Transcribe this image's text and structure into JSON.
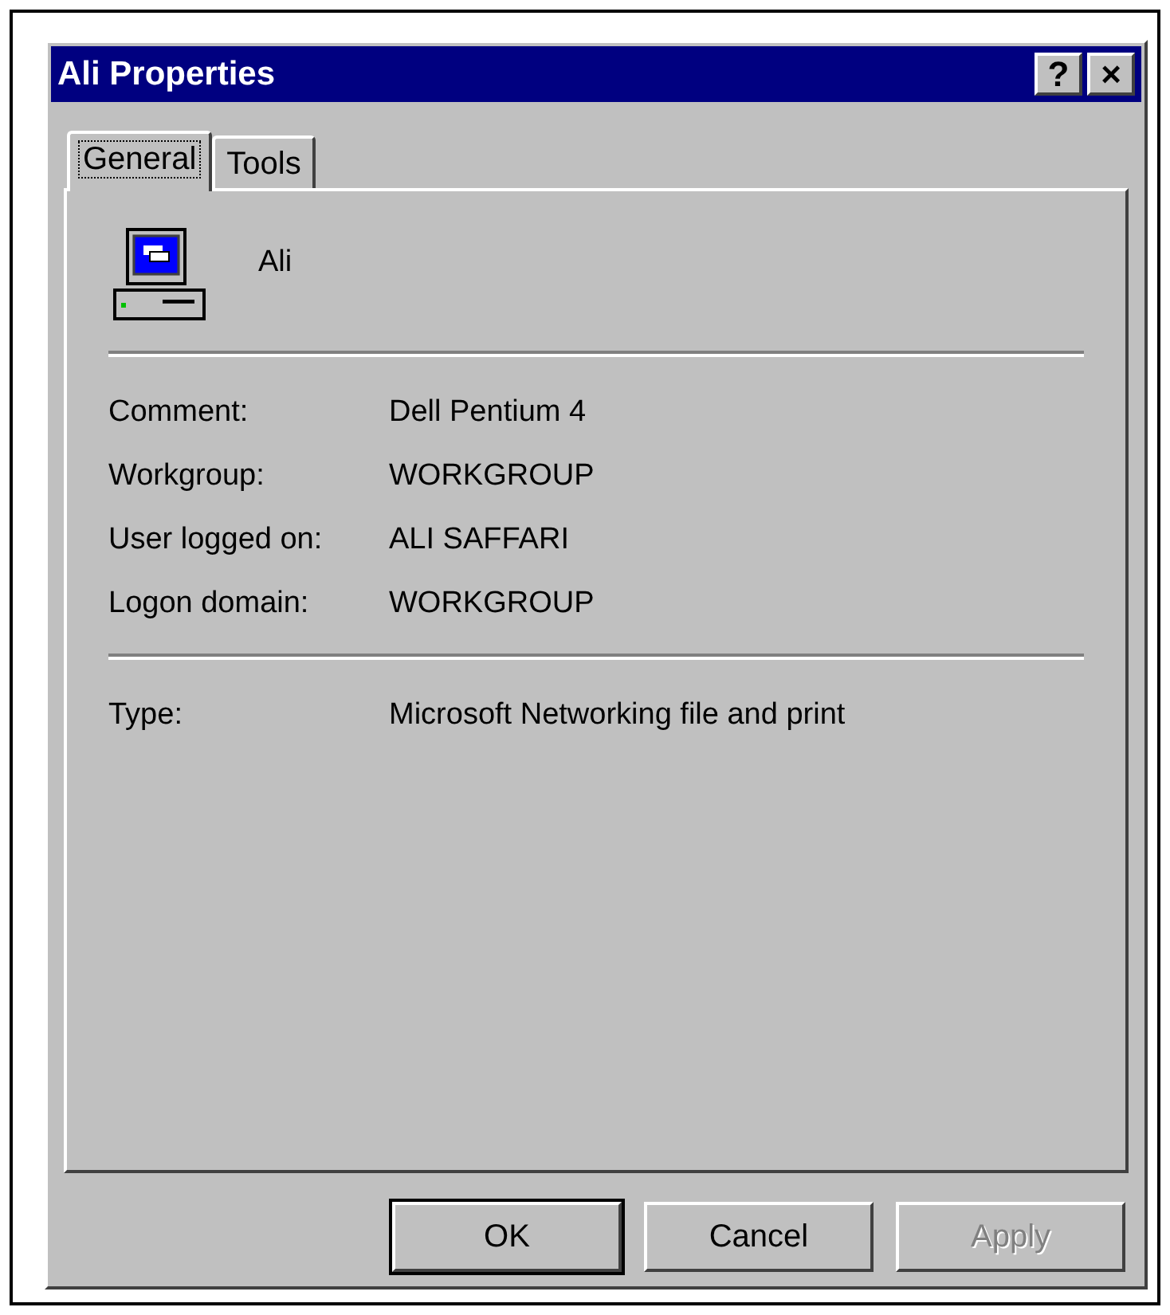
{
  "window": {
    "title": "Ali Properties",
    "title_buttons": [
      {
        "label": "?"
      },
      {
        "label": "×"
      }
    ]
  },
  "tabs": [
    {
      "label": "General",
      "selected": true
    },
    {
      "label": "Tools",
      "selected": false
    }
  ],
  "computer": {
    "name": "Ali"
  },
  "groups": [
    [
      {
        "label": "Comment:",
        "value": "Dell Pentium 4"
      },
      {
        "label": "Workgroup:",
        "value": "WORKGROUP"
      },
      {
        "label": "User logged on:",
        "value": "ALI SAFFARI"
      },
      {
        "label": "Logon domain:",
        "value": "WORKGROUP"
      }
    ],
    [
      {
        "label": "Type:",
        "value": "Microsoft Networking file and print"
      }
    ]
  ],
  "buttons": [
    {
      "label": "OK",
      "default": true,
      "disabled": false
    },
    {
      "label": "Cancel",
      "default": false,
      "disabled": false
    },
    {
      "label": "Apply",
      "default": false,
      "disabled": true
    }
  ]
}
